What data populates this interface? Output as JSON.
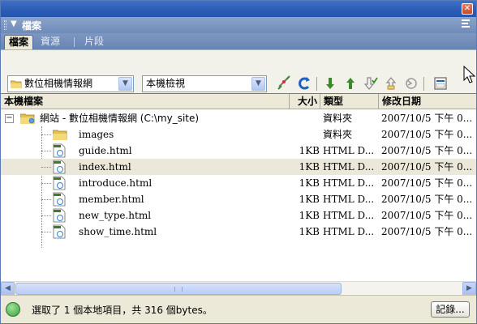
{
  "panel": {
    "title": "檔案"
  },
  "tabs": [
    {
      "label": "檔案",
      "active": true
    },
    {
      "label": "資源",
      "active": false
    },
    {
      "label": "片段",
      "active": false
    }
  ],
  "toolbar": {
    "site_select": "數位相機情報網",
    "view_select": "本機檢視",
    "icons": [
      "connect-icon",
      "refresh-icon",
      "get-file-icon",
      "put-file-icon",
      "check-out-icon",
      "check-in-icon",
      "synchronize-icon",
      "expand-icon"
    ]
  },
  "columns": {
    "name": "本機檔案",
    "size": "大小",
    "type": "類型",
    "date": "修改日期"
  },
  "root": {
    "expander": "−",
    "name": "網站 - 數位相機情報網 (C:\\my_site)",
    "type": "資料夾",
    "date": "2007/10/5 下午 0..."
  },
  "items": [
    {
      "name": "images",
      "size": "",
      "type": "資料夾",
      "date": "2007/10/5 下午 0...",
      "kind": "folder",
      "selected": false
    },
    {
      "name": "guide.html",
      "size": "1KB",
      "type": "HTML D...",
      "date": "2007/10/5 下午 0...",
      "kind": "html",
      "selected": false
    },
    {
      "name": "index.html",
      "size": "1KB",
      "type": "HTML D...",
      "date": "2007/10/5 下午 0...",
      "kind": "html",
      "selected": true
    },
    {
      "name": "introduce.html",
      "size": "1KB",
      "type": "HTML D...",
      "date": "2007/10/5 下午 0...",
      "kind": "html",
      "selected": false
    },
    {
      "name": "member.html",
      "size": "1KB",
      "type": "HTML D...",
      "date": "2007/10/5 下午 0...",
      "kind": "html",
      "selected": false
    },
    {
      "name": "new_type.html",
      "size": "1KB",
      "type": "HTML D...",
      "date": "2007/10/5 下午 0...",
      "kind": "html",
      "selected": false
    },
    {
      "name": "show_time.html",
      "size": "1KB",
      "type": "HTML D...",
      "date": "2007/10/5 下午 0...",
      "kind": "html",
      "selected": false
    }
  ],
  "status": {
    "text": "選取了 1 個本地項目，共 316 個bytes。",
    "log_button": "記錄..."
  },
  "colors": {
    "titlebar": "#2b5bb4",
    "panel_header": "#7a94c0",
    "selected_row": "#ebe8da",
    "refresh": "#1f5fbf",
    "arrows": "#3a8a2a"
  }
}
